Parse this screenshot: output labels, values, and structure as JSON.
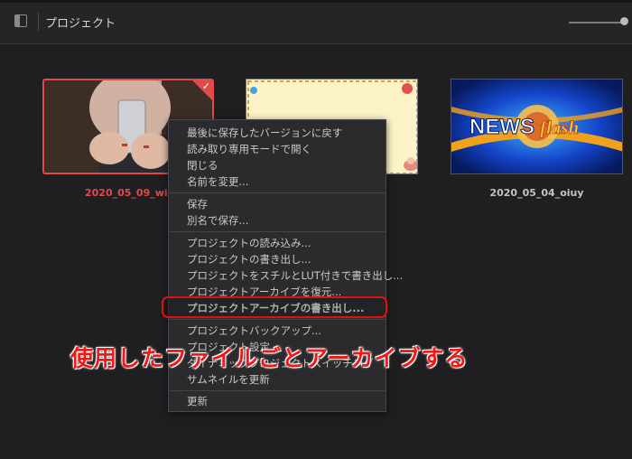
{
  "header": {
    "title": "プロジェクト"
  },
  "projects": [
    {
      "name": "2020_05_09_wipe",
      "selected": true
    },
    {
      "name": "",
      "selected": false
    },
    {
      "name": "2020_05_04_oiuy",
      "selected": false
    }
  ],
  "thumb3_text": {
    "news": "NEWS",
    "flash": "flash"
  },
  "menu": {
    "items": [
      "最後に保存したバージョンに戻す",
      "読み取り専用モードで開く",
      "閉じる",
      "名前を変更...",
      "保存",
      "別名で保存...",
      "プロジェクトの読み込み...",
      "プロジェクトの書き出し...",
      "プロジェクトをスチルとLUT付きで書き出し...",
      "プロジェクトアーカイブを復元...",
      "プロジェクトアーカイブの書き出し...",
      "プロジェクトバックアップ...",
      "プロジェクト設定...",
      "ダイナミックプロジェクトスイッチング",
      "サムネイルを更新",
      "更新"
    ]
  },
  "annotation": "使用したファイルごとアーカイブする",
  "colors": {
    "accent": "#e04a4a",
    "annotation": "#ee1a1a"
  }
}
